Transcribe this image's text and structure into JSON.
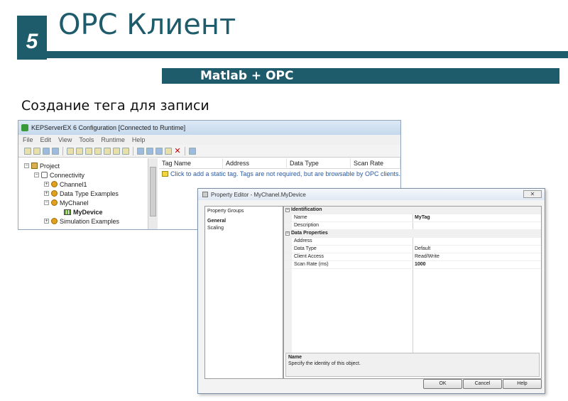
{
  "slide": {
    "number": "5",
    "title": "ОРС Клиент",
    "banner": "Matlab + OPC",
    "subtitle": "Создание тега для записи",
    "accent_color": "#1f5c6b"
  },
  "kep": {
    "title": "KEPServerEX 6 Configuration [Connected to Runtime]",
    "menu": [
      "File",
      "Edit",
      "View",
      "Tools",
      "Runtime",
      "Help"
    ],
    "tree": {
      "project": "Project",
      "connectivity": "Connectivity",
      "channel1": "Channel1",
      "data_type_examples": "Data Type Examples",
      "mychanel": "MyChanel",
      "mydevice": "MyDevice",
      "simulation_examples": "Simulation Examples"
    },
    "columns": [
      "Tag Name",
      "Address",
      "Data Type",
      "Scan Rate"
    ],
    "hint": "Click to add a static tag. Tags are not required, but are browsable by OPC clients."
  },
  "dialog": {
    "title": "Property Editor - MyChanel.MyDevice",
    "groups_header": "Property Groups",
    "groups": [
      "General",
      "Scaling"
    ],
    "cat_identification": "Identification",
    "name_label": "Name",
    "name_value": "MyTag",
    "description_label": "Description",
    "cat_data_properties": "Data Properties",
    "address_label": "Address",
    "data_type_label": "Data Type",
    "data_type_value": "Default",
    "client_access_label": "Client Access",
    "client_access_value": "Read/Write",
    "scan_rate_label": "Scan Rate (ms)",
    "scan_rate_value": "1000",
    "desc_title": "Name",
    "desc_text": "Specify the identity of this object.",
    "ok": "OK",
    "cancel": "Cancel",
    "help": "Help"
  }
}
